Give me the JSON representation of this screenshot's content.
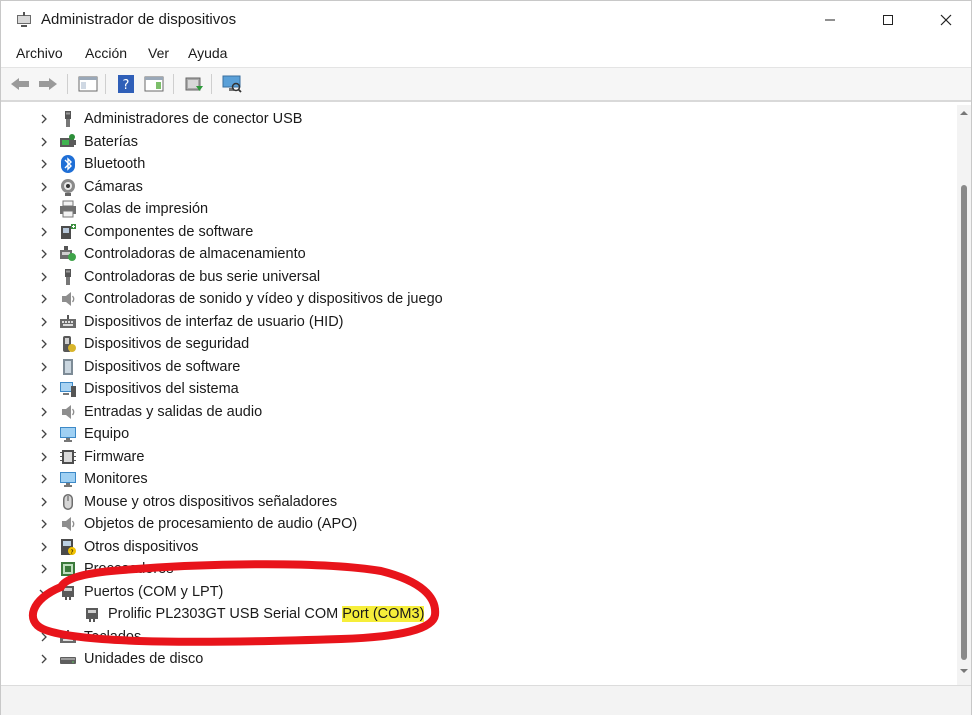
{
  "window": {
    "title": "Administrador de dispositivos"
  },
  "window_controls": [
    "minimize-icon",
    "maximize-icon",
    "close-icon"
  ],
  "menu": [
    "Archivo",
    "Acción",
    "Ver",
    "Ayuda"
  ],
  "toolbar": [
    "back-arrow-icon",
    "forward-arrow-icon",
    "show-hide-console-tree-icon",
    "help-icon",
    "action-pane-icon",
    "update-driver-icon",
    "scan-hardware-icon"
  ],
  "tree": {
    "items": [
      {
        "label": "Administradores de conector USB",
        "icon": "usb-plug-icon"
      },
      {
        "label": "Baterías",
        "icon": "battery-icon"
      },
      {
        "label": "Bluetooth",
        "icon": "bluetooth-icon"
      },
      {
        "label": "Cámaras",
        "icon": "webcam-icon"
      },
      {
        "label": "Colas de impresión",
        "icon": "printer-icon"
      },
      {
        "label": "Componentes de software",
        "icon": "software-component-icon"
      },
      {
        "label": "Controladoras de almacenamiento",
        "icon": "storage-controller-icon"
      },
      {
        "label": "Controladoras de bus serie universal",
        "icon": "usb-plug-icon"
      },
      {
        "label": "Controladoras de sonido y vídeo y dispositivos de juego",
        "icon": "speaker-icon"
      },
      {
        "label": "Dispositivos de interfaz de usuario (HID)",
        "icon": "keyboard-icon"
      },
      {
        "label": "Dispositivos de seguridad",
        "icon": "security-key-icon"
      },
      {
        "label": "Dispositivos de software",
        "icon": "software-device-icon"
      },
      {
        "label": "Dispositivos del sistema",
        "icon": "system-device-icon"
      },
      {
        "label": "Entradas y salidas de audio",
        "icon": "speaker-icon"
      },
      {
        "label": "Equipo",
        "icon": "monitor-icon"
      },
      {
        "label": "Firmware",
        "icon": "firmware-chip-icon"
      },
      {
        "label": "Monitores",
        "icon": "monitor-icon"
      },
      {
        "label": "Mouse y otros dispositivos señaladores",
        "icon": "mouse-icon"
      },
      {
        "label": "Objetos de procesamiento de audio (APO)",
        "icon": "speaker-icon"
      },
      {
        "label": "Otros dispositivos",
        "icon": "unknown-device-icon"
      },
      {
        "label": "Procesadores",
        "icon": "processor-icon"
      },
      {
        "label": "Puertos (COM y LPT)",
        "icon": "port-icon",
        "expanded": true
      },
      {
        "label": "Prolific PL2303GT USB Serial COM ",
        "highlighted": "Port (COM3)",
        "icon": "port-icon",
        "child": true
      },
      {
        "label": "Teclados",
        "icon": "keyboard-icon"
      },
      {
        "label": "Unidades de disco",
        "icon": "disk-drive-icon"
      }
    ]
  },
  "annotation": {
    "color": "#e8141b"
  },
  "colors": {
    "highlight": "#f6ee3a",
    "annotation": "#e8141b",
    "scroll_thumb": "#8a8a8a"
  }
}
